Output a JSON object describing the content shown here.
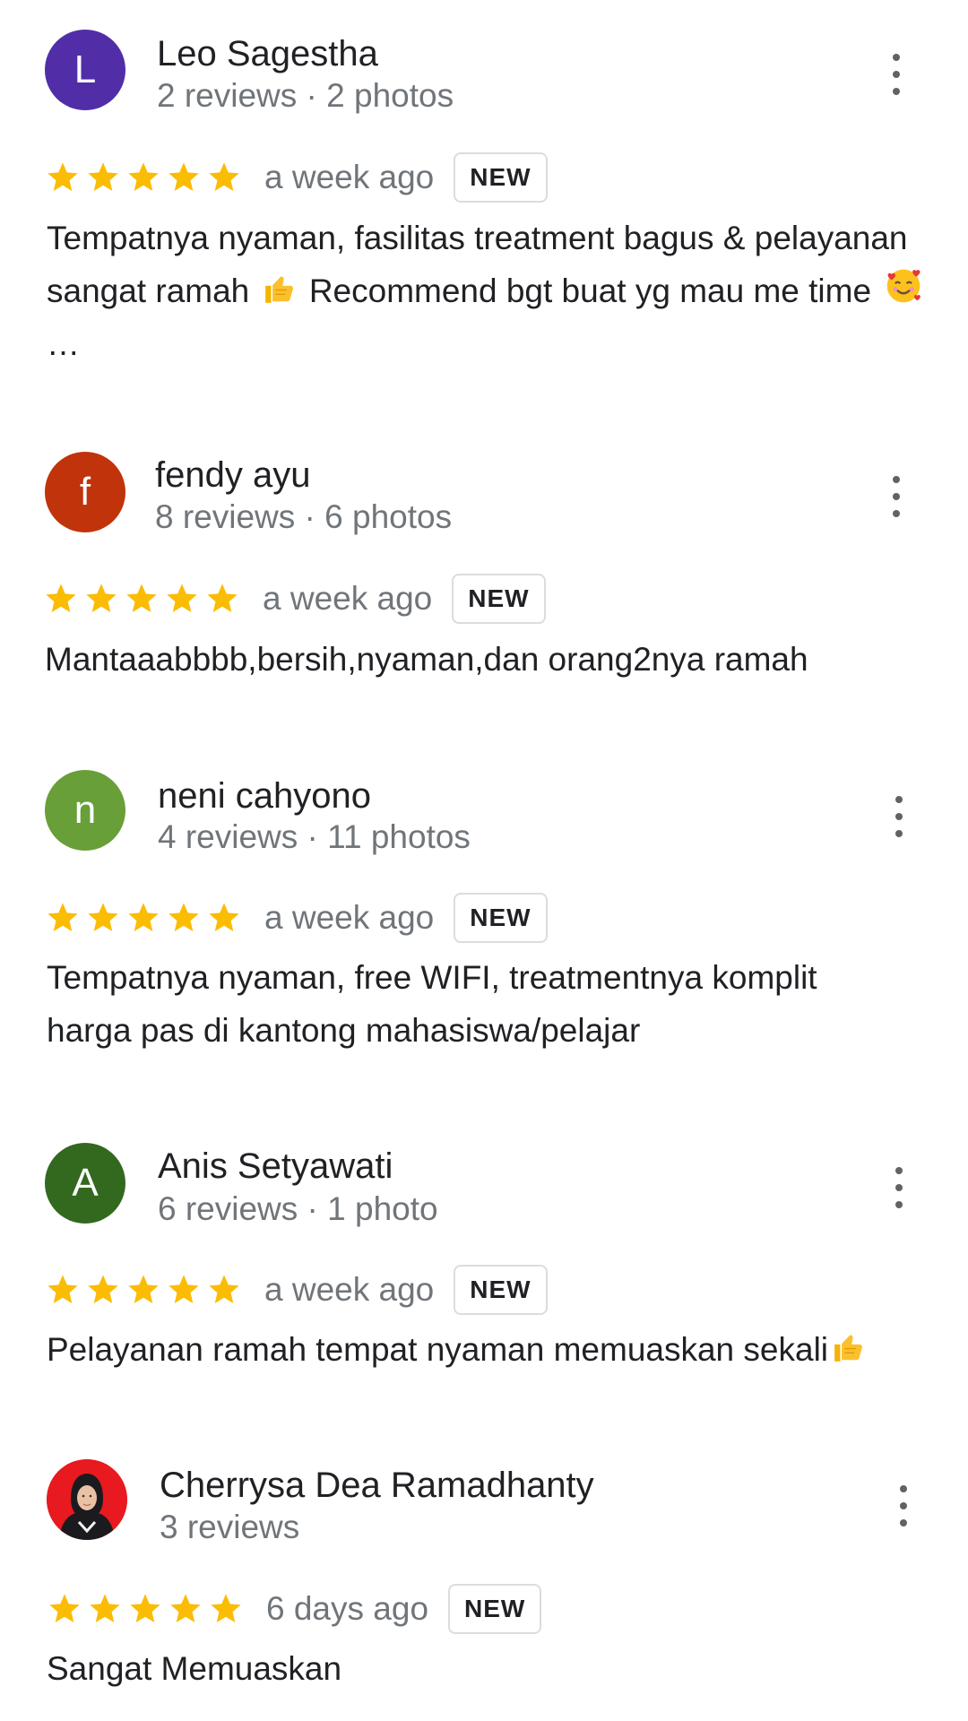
{
  "reviews": [
    {
      "initial": "L",
      "avatar_color": "#512da8",
      "name": "Leo Sagestha",
      "meta": "2 reviews · 2 photos",
      "rating": 5,
      "date": "a week ago",
      "badge": "NEW",
      "text_parts": [
        "Tempatnya nyaman, fasilitas treatment bagus & pelayanan sangat ramah",
        "Recommend bgt buat yg mau me time",
        "…"
      ],
      "emojis": [
        "thumbs-up",
        "smiling-face-with-hearts"
      ]
    },
    {
      "initial": "f",
      "avatar_color": "#c1330b",
      "name": "fendy ayu",
      "meta": "8 reviews · 6 photos",
      "rating": 5,
      "date": "a week ago",
      "badge": "NEW",
      "text": "Mantaaabbbb,bersih,nyaman,dan orang2nya ramah"
    },
    {
      "initial": "n",
      "avatar_color": "#689f38",
      "name": "neni cahyono",
      "meta": "4 reviews · 11 photos",
      "rating": 5,
      "date": "a week ago",
      "badge": "NEW",
      "text": "Tempatnya nyaman, free WIFI, treatmentnya komplit harga pas di kantong mahasiswa/pelajar"
    },
    {
      "initial": "A",
      "avatar_color": "#33691e",
      "name": "Anis Setyawati",
      "meta": "6 reviews · 1 photo",
      "rating": 5,
      "date": "a week ago",
      "badge": "NEW",
      "text": "Pelayanan ramah tempat nyaman memuaskan sekali",
      "emojis": [
        "thumbs-up"
      ]
    },
    {
      "name": "Cherrysa Dea Ramadhanty",
      "meta": "3 reviews",
      "avatar_color": "#e8191f",
      "rating": 5,
      "date": "6 days ago",
      "badge": "NEW",
      "text": "Sangat Memuaskan"
    }
  ],
  "colors": {
    "star": "#fbbc04",
    "secondary_text": "#70757a"
  }
}
